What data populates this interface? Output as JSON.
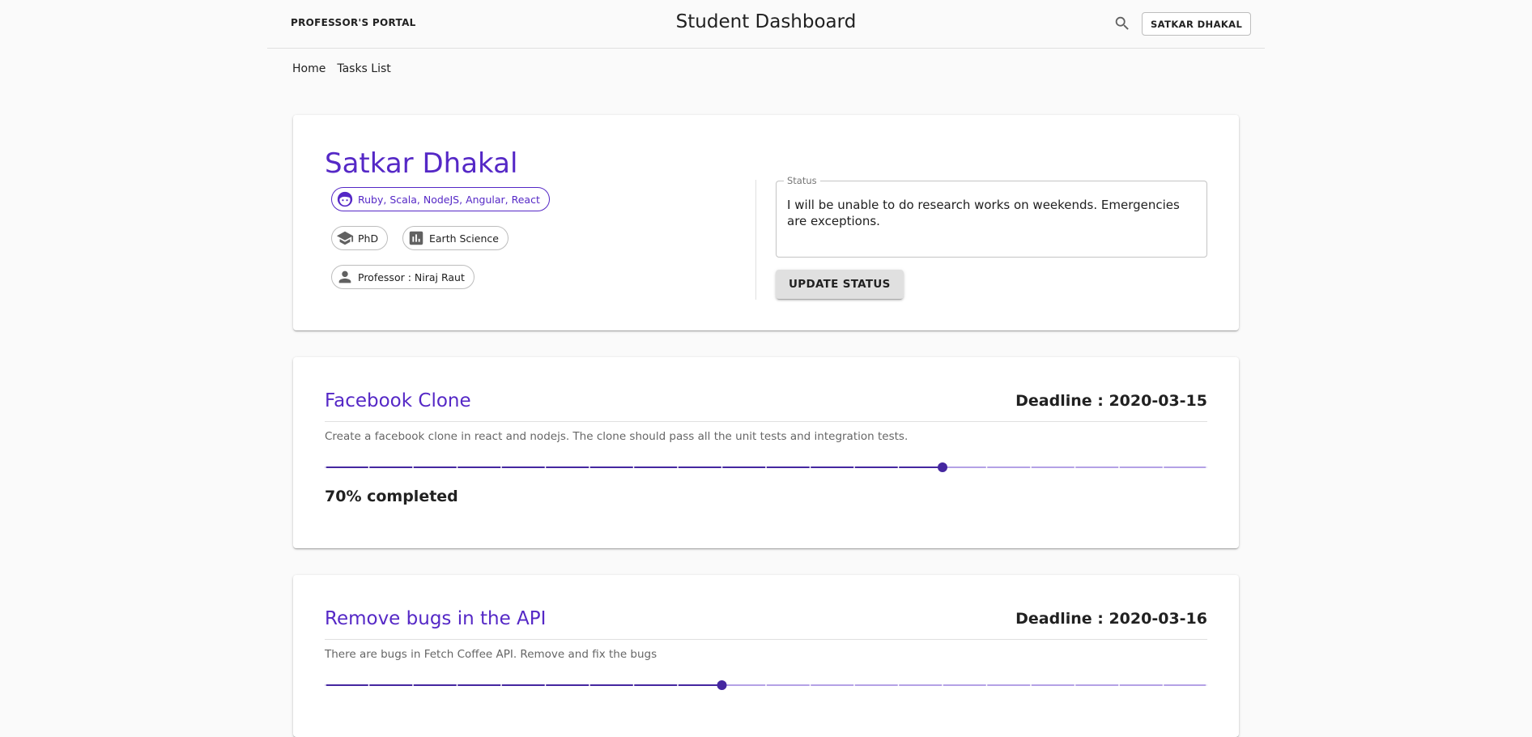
{
  "header": {
    "brand": "PROFESSOR'S PORTAL",
    "title": "Student Dashboard",
    "user_button": "SATKAR DHAKAL"
  },
  "nav": {
    "home": "Home",
    "tasks": "Tasks List"
  },
  "profile": {
    "name": "Satkar Dhakal",
    "skills": "Ruby, Scala, NodeJS, Angular, React",
    "degree": "PhD",
    "department": "Earth Science",
    "professor": "Professor : Niraj Raut",
    "status_label": "Status",
    "status_text": "I will be unable to do research works on weekends. Emergencies are exceptions.",
    "update_button": "UPDATE STATUS"
  },
  "colors": {
    "accent": "#5528c6",
    "slider_track": "#b4a1e6",
    "slider_fill": "#4527a0"
  },
  "tasks": [
    {
      "title": "Facebook Clone",
      "deadline": "Deadline : 2020-03-15",
      "description": "Create a facebook clone in react and nodejs. The clone should pass all the unit tests and integration tests.",
      "progress": 70,
      "progress_label": "70% completed"
    },
    {
      "title": "Remove bugs in the API",
      "deadline": "Deadline : 2020-03-16",
      "description": "There are bugs in Fetch Coffee API. Remove and fix the bugs",
      "progress": 45
    }
  ]
}
